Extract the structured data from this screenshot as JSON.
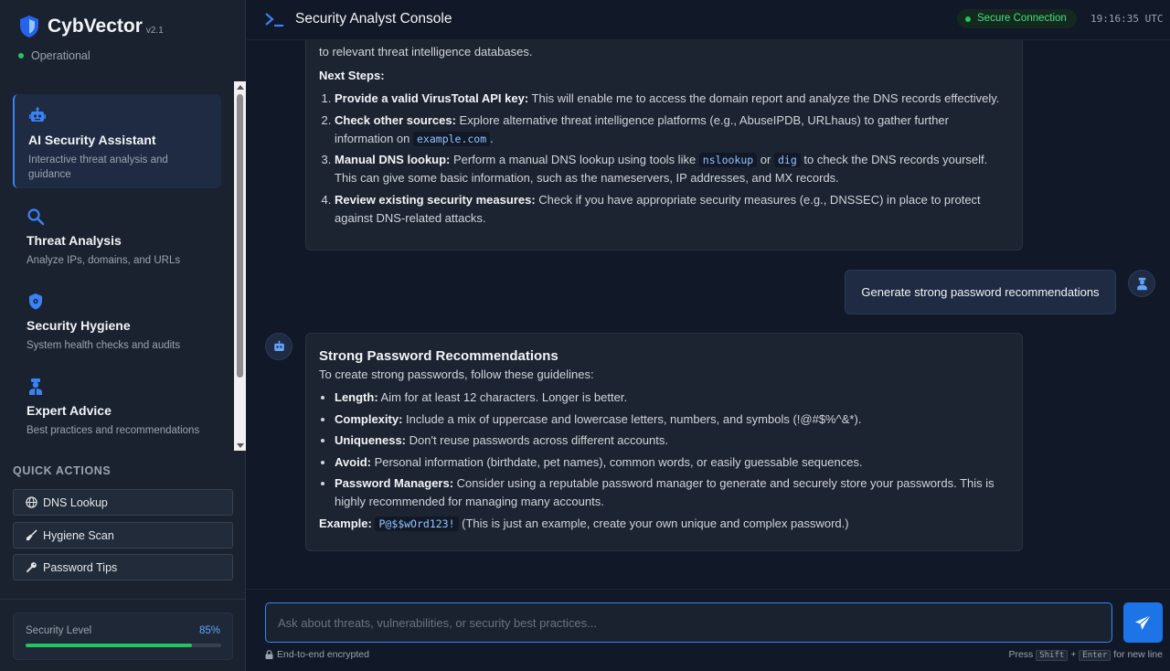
{
  "app": {
    "name": "CybVector",
    "version": "v2.1",
    "status": "Operational"
  },
  "nav": [
    {
      "title": "AI Security Assistant",
      "desc": "Interactive threat analysis and guidance",
      "icon": "robot-icon"
    },
    {
      "title": "Threat Analysis",
      "desc": "Analyze IPs, domains, and URLs",
      "icon": "search-icon"
    },
    {
      "title": "Security Hygiene",
      "desc": "System health checks and audits",
      "icon": "shield-virus-icon"
    },
    {
      "title": "Expert Advice",
      "desc": "Best practices and recommendations",
      "icon": "expert-icon"
    }
  ],
  "quick_actions": {
    "heading": "QUICK ACTIONS",
    "items": [
      {
        "label": "DNS Lookup",
        "icon": "globe-icon"
      },
      {
        "label": "Hygiene Scan",
        "icon": "broom-icon"
      },
      {
        "label": "Password Tips",
        "icon": "key-icon"
      }
    ]
  },
  "security_level": {
    "label": "Security Level",
    "value": "85%",
    "fraction": 0.85
  },
  "header": {
    "title": "Security Analyst Console",
    "secure": "Secure Connection",
    "time": "19:16:35 UTC"
  },
  "msg1": {
    "intro_end": "to relevant threat intelligence databases.",
    "next_steps": "Next Steps:",
    "s1b": "Provide a valid VirusTotal API key:",
    "s1": " This will enable me to access the domain report and analyze the DNS records effectively.",
    "s2b": "Check other sources:",
    "s2a": " Explore alternative threat intelligence platforms (e.g., AbuseIPDB, URLhaus) to gather further information on ",
    "s2code": "example.com",
    "s2c": ".",
    "s3b": "Manual DNS lookup:",
    "s3a": " Perform a manual DNS lookup using tools like ",
    "s3code1": "nslookup",
    "s3or": " or ",
    "s3code2": "dig",
    "s3c": " to check the DNS records yourself. This can give some basic information, such as the nameservers, IP addresses, and MX records.",
    "s4b": "Review existing security measures:",
    "s4": " Check if you have appropriate security measures (e.g., DNSSEC) in place to protect against DNS-related attacks."
  },
  "user_msg": "Generate strong password recommendations",
  "msg2": {
    "title": "Strong Password Recommendations",
    "intro": "To create strong passwords, follow these guidelines:",
    "items": [
      {
        "b": "Length:",
        "t": " Aim for at least 12 characters. Longer is better."
      },
      {
        "b": "Complexity:",
        "t": " Include a mix of uppercase and lowercase letters, numbers, and symbols (!@#$%^&*)."
      },
      {
        "b": "Uniqueness:",
        "t": " Don't reuse passwords across different accounts."
      },
      {
        "b": "Avoid:",
        "t": " Personal information (birthdate, pet names), common words, or easily guessable sequences."
      },
      {
        "b": "Password Managers:",
        "t": " Consider using a reputable password manager to generate and securely store your passwords. This is highly recommended for managing many accounts."
      }
    ],
    "example_label": "Example:",
    "example_code": "P@$$wOrd123!",
    "example_note": " (This is just an example, create your own unique and complex password.)"
  },
  "input": {
    "placeholder": "Ask about threats, vulnerabilities, or security best practices...",
    "encrypted": "End-to-end encrypted",
    "hint_pre": "Press ",
    "k1": "Shift",
    "plus": " + ",
    "k2": "Enter",
    "hint_post": " for new line"
  },
  "colors": {
    "accent": "#3b82f6",
    "success": "#22c55e",
    "bg": "#111827"
  }
}
